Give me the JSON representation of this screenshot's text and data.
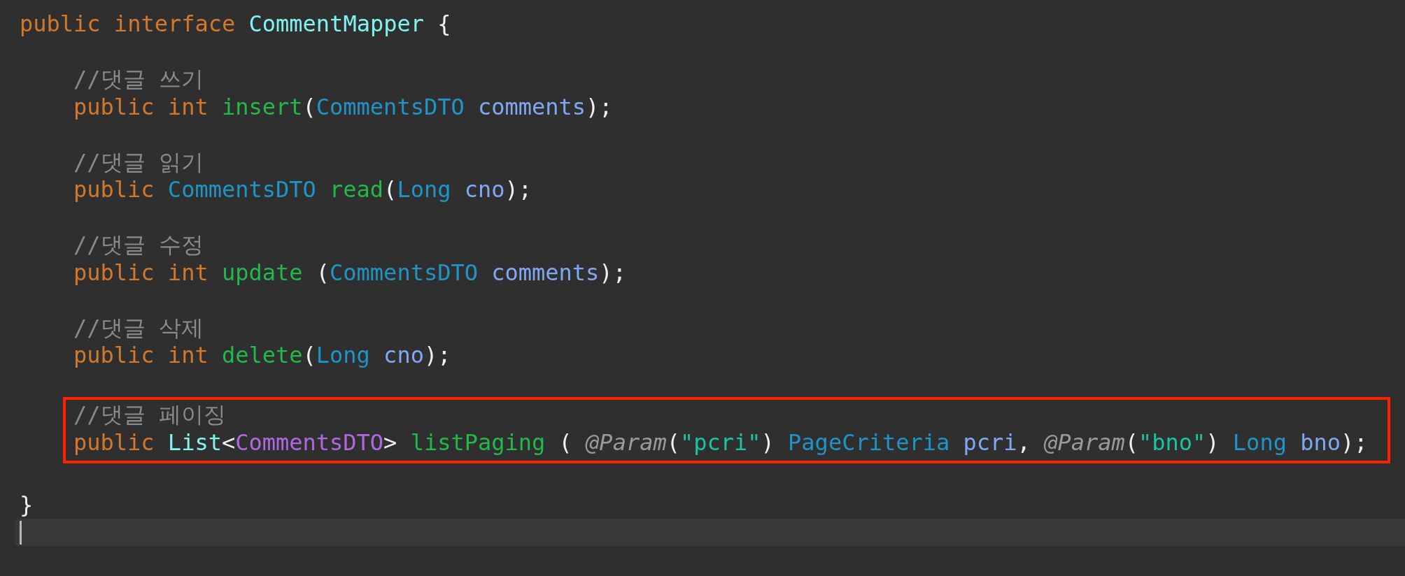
{
  "editor": {
    "lines": [
      {
        "kind": "code",
        "tokens": [
          {
            "kind": "keyword",
            "text": "public interface "
          },
          {
            "kind": "classname",
            "text": "CommentMapper"
          },
          {
            "kind": "punct",
            "text": " {"
          }
        ],
        "children": [
          {
            "kind": "blank"
          },
          {
            "kind": "code",
            "tokens": [
              {
                "kind": "comment",
                "text": "//댓글 쓰기"
              }
            ]
          },
          {
            "kind": "code",
            "tokens": [
              {
                "kind": "keyword",
                "text": "public int "
              },
              {
                "kind": "method",
                "text": "insert"
              },
              {
                "kind": "punct",
                "text": "("
              },
              {
                "kind": "type",
                "text": "CommentsDTO "
              },
              {
                "kind": "variable",
                "text": "comments"
              },
              {
                "kind": "punct",
                "text": ");"
              }
            ]
          },
          {
            "kind": "blank"
          },
          {
            "kind": "code",
            "tokens": [
              {
                "kind": "comment",
                "text": "//댓글 읽기"
              }
            ]
          },
          {
            "kind": "code",
            "tokens": [
              {
                "kind": "keyword",
                "text": "public "
              },
              {
                "kind": "type",
                "text": "CommentsDTO "
              },
              {
                "kind": "method",
                "text": "read"
              },
              {
                "kind": "punct",
                "text": "("
              },
              {
                "kind": "type",
                "text": "Long "
              },
              {
                "kind": "variable",
                "text": "cno"
              },
              {
                "kind": "punct",
                "text": ");"
              }
            ]
          },
          {
            "kind": "blank"
          },
          {
            "kind": "code",
            "tokens": [
              {
                "kind": "comment",
                "text": "//댓글 수정"
              }
            ]
          },
          {
            "kind": "code",
            "tokens": [
              {
                "kind": "keyword",
                "text": "public int "
              },
              {
                "kind": "method",
                "text": "update"
              },
              {
                "kind": "punct",
                "text": " ("
              },
              {
                "kind": "type",
                "text": "CommentsDTO "
              },
              {
                "kind": "variable",
                "text": "comments"
              },
              {
                "kind": "punct",
                "text": ");"
              }
            ]
          },
          {
            "kind": "blank"
          },
          {
            "kind": "code",
            "tokens": [
              {
                "kind": "comment",
                "text": "//댓글 삭제"
              }
            ]
          },
          {
            "kind": "code",
            "tokens": [
              {
                "kind": "keyword",
                "text": "public int "
              },
              {
                "kind": "method",
                "text": "delete"
              },
              {
                "kind": "punct",
                "text": "("
              },
              {
                "kind": "type",
                "text": "Long "
              },
              {
                "kind": "variable",
                "text": "cno"
              },
              {
                "kind": "punct",
                "text": ");"
              }
            ]
          },
          {
            "kind": "blank"
          },
          {
            "kind": "highlighted",
            "lines": [
              {
                "kind": "code",
                "tokens": [
                  {
                    "kind": "comment",
                    "text": "//댓글 페이징"
                  }
                ]
              },
              {
                "kind": "code",
                "tokens": [
                  {
                    "kind": "keyword",
                    "text": "public "
                  },
                  {
                    "kind": "classname",
                    "text": "List"
                  },
                  {
                    "kind": "punct",
                    "text": "<"
                  },
                  {
                    "kind": "generic",
                    "text": "CommentsDTO"
                  },
                  {
                    "kind": "punct",
                    "text": "> "
                  },
                  {
                    "kind": "method",
                    "text": "listPaging"
                  },
                  {
                    "kind": "punct",
                    "text": " ( "
                  },
                  {
                    "kind": "annotation",
                    "text": "@Param"
                  },
                  {
                    "kind": "punct",
                    "text": "("
                  },
                  {
                    "kind": "string",
                    "text": "\"pcri\""
                  },
                  {
                    "kind": "punct",
                    "text": ") "
                  },
                  {
                    "kind": "type",
                    "text": "PageCriteria "
                  },
                  {
                    "kind": "variable",
                    "text": "pcri"
                  },
                  {
                    "kind": "punct",
                    "text": ", "
                  },
                  {
                    "kind": "annotation",
                    "text": "@Param"
                  },
                  {
                    "kind": "punct",
                    "text": "("
                  },
                  {
                    "kind": "string",
                    "text": "\"bno\""
                  },
                  {
                    "kind": "punct",
                    "text": ") "
                  },
                  {
                    "kind": "type",
                    "text": "Long "
                  },
                  {
                    "kind": "variable",
                    "text": "bno"
                  },
                  {
                    "kind": "punct",
                    "text": ");"
                  }
                ]
              }
            ]
          },
          {
            "kind": "blank"
          }
        ]
      },
      {
        "kind": "code",
        "tokens": [
          {
            "kind": "punct",
            "text": "}"
          }
        ]
      },
      {
        "kind": "cursor"
      }
    ]
  }
}
